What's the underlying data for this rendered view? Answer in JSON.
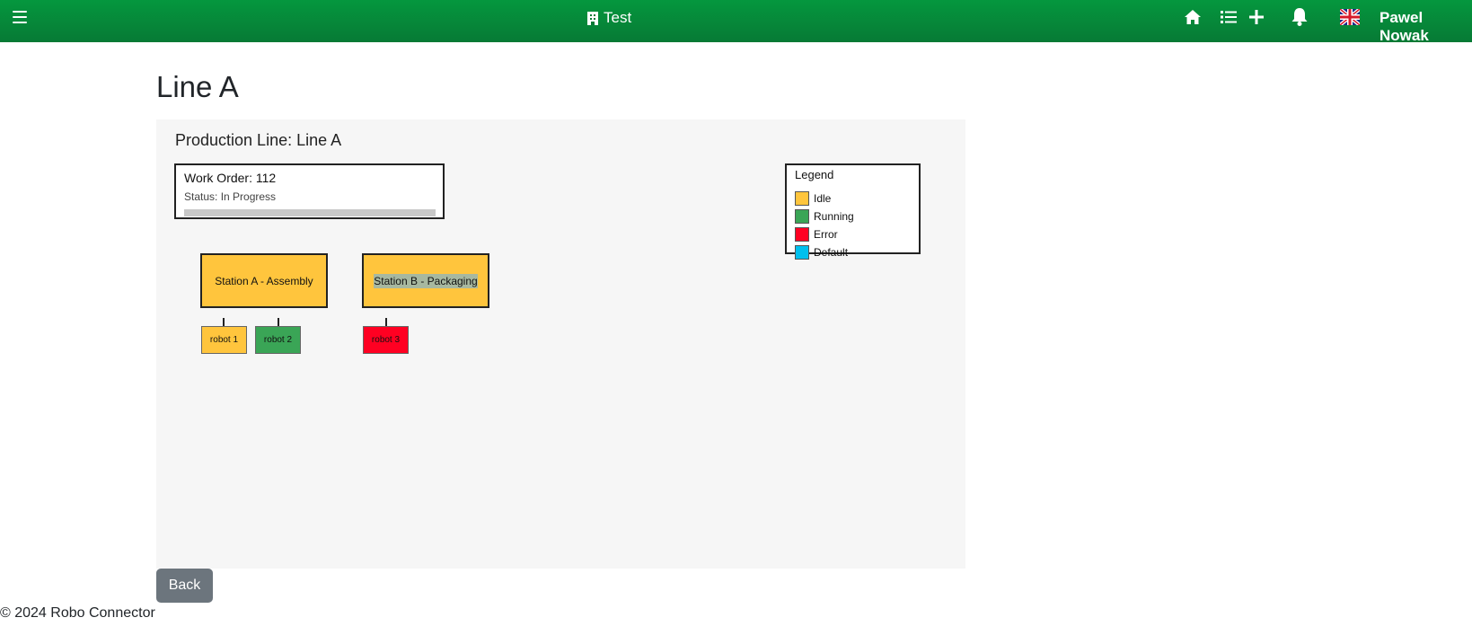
{
  "header": {
    "brand_label": "Test",
    "user_name": "Pawel Nowak",
    "icons": [
      "menu-icon",
      "building-icon",
      "home-icon",
      "list-icon",
      "plus-icon",
      "bell-icon",
      "uk-flag-icon"
    ]
  },
  "page": {
    "title": "Line A"
  },
  "panel": {
    "title": "Production Line: Line A",
    "work_order": {
      "title": "Work Order: 112",
      "status": "Status: In Progress",
      "progress": 0
    },
    "stations": [
      {
        "name": "Station A - Assembly",
        "status": "Idle",
        "color": "#ffc53d"
      },
      {
        "name": "Station B - Packaging",
        "status": "Idle",
        "color": "#ffc53d"
      }
    ],
    "robots": [
      {
        "name": "robot 1",
        "station": "Station A - Assembly",
        "status": "Idle",
        "color": "#ffc53d"
      },
      {
        "name": "robot 2",
        "station": "Station A - Assembly",
        "status": "Running",
        "color": "#3aa556"
      },
      {
        "name": "robot 3",
        "station": "Station B - Packaging",
        "status": "Error",
        "color": "#ff0022"
      }
    ],
    "legend": {
      "title": "Legend",
      "items": [
        {
          "label": "Idle",
          "color": "#ffc53d"
        },
        {
          "label": "Running",
          "color": "#3aa556"
        },
        {
          "label": "Error",
          "color": "#ff0022"
        },
        {
          "label": "Default",
          "color": "#00c0ee"
        }
      ]
    }
  },
  "actions": {
    "back_label": "Back"
  },
  "footer": {
    "text": "© 2024 Robo Connector"
  },
  "colors": {
    "topbar": "#05973e",
    "panel_bg": "#f6f6f6",
    "back_button": "#6c757d"
  }
}
